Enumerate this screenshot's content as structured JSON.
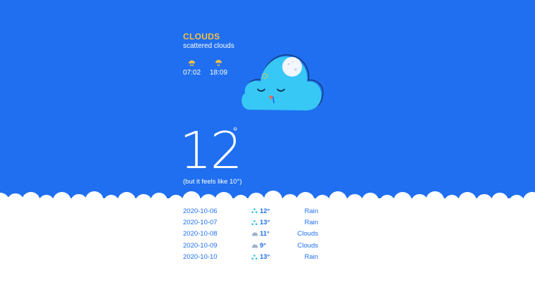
{
  "current": {
    "condition": "CLOUDS",
    "description": "scattered clouds",
    "sunrise": "07:02",
    "sunset": "18:09",
    "temperature": "12",
    "unit": "°",
    "feels_like": "(but it feels like 10°)"
  },
  "forecast": [
    {
      "date": "2020-10-06",
      "icon": "rain-icon",
      "temp": "12°",
      "condition": "Rain"
    },
    {
      "date": "2020-10-07",
      "icon": "rain-icon",
      "temp": "13°",
      "condition": "Rain"
    },
    {
      "date": "2020-10-08",
      "icon": "cloud-icon",
      "temp": "11°",
      "condition": "Clouds"
    },
    {
      "date": "2020-10-09",
      "icon": "cloud-icon",
      "temp": "9°",
      "condition": "Clouds"
    },
    {
      "date": "2020-10-10",
      "icon": "rain-icon",
      "temp": "13°",
      "condition": "Rain"
    }
  ],
  "colors": {
    "sky": "#1f6ff0",
    "accent": "#f6c042",
    "mascot": "#37c8f5",
    "rain": "#27c2d6",
    "cloud_icon": "#9eb3c9"
  }
}
